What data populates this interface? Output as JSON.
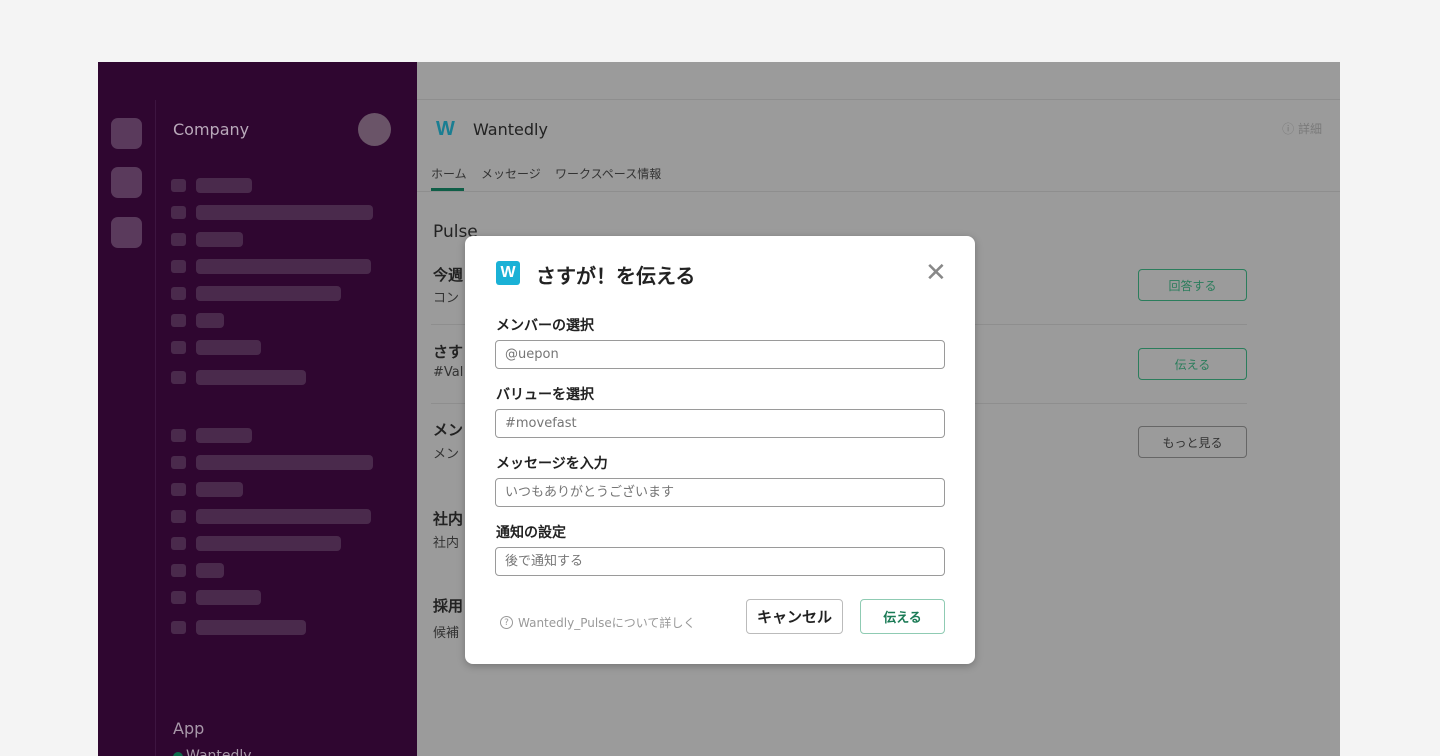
{
  "sidebar": {
    "workspace": "Company",
    "app_section": "App",
    "app_item": "Wantedly"
  },
  "header": {
    "title": "Wantedly",
    "logo": "W",
    "detail": "詳細",
    "tabs": [
      "ホーム",
      "メッセージ",
      "ワークスペース情報"
    ]
  },
  "main": {
    "section": "Pulse",
    "rows": [
      {
        "title": "今週",
        "sub": "コン",
        "button": "回答する"
      },
      {
        "title": "さす",
        "sub": "#Val",
        "button": "伝える"
      },
      {
        "title": "メン",
        "sub": "メン",
        "button": "もっと見る"
      },
      {
        "title": "社内",
        "sub": "社内"
      },
      {
        "title": "採用",
        "sub": "候補"
      }
    ]
  },
  "modal": {
    "logo": "W",
    "title": "さすが！を伝える",
    "fields": [
      {
        "label": "メンバーの選択",
        "placeholder": "@uepon"
      },
      {
        "label": "バリューを選択",
        "placeholder": "#movefast"
      },
      {
        "label": "メッセージを入力",
        "placeholder": "いつもありがとうございます"
      },
      {
        "label": "通知の設定",
        "placeholder": "後で通知する"
      }
    ],
    "help": "Wantedly_Pulseについて詳しく",
    "cancel": "キャンセル",
    "submit": "伝える"
  },
  "colors": {
    "sidebar": "#2f0630",
    "accent": "#1a7a55",
    "brand": "#1ab1d6"
  }
}
